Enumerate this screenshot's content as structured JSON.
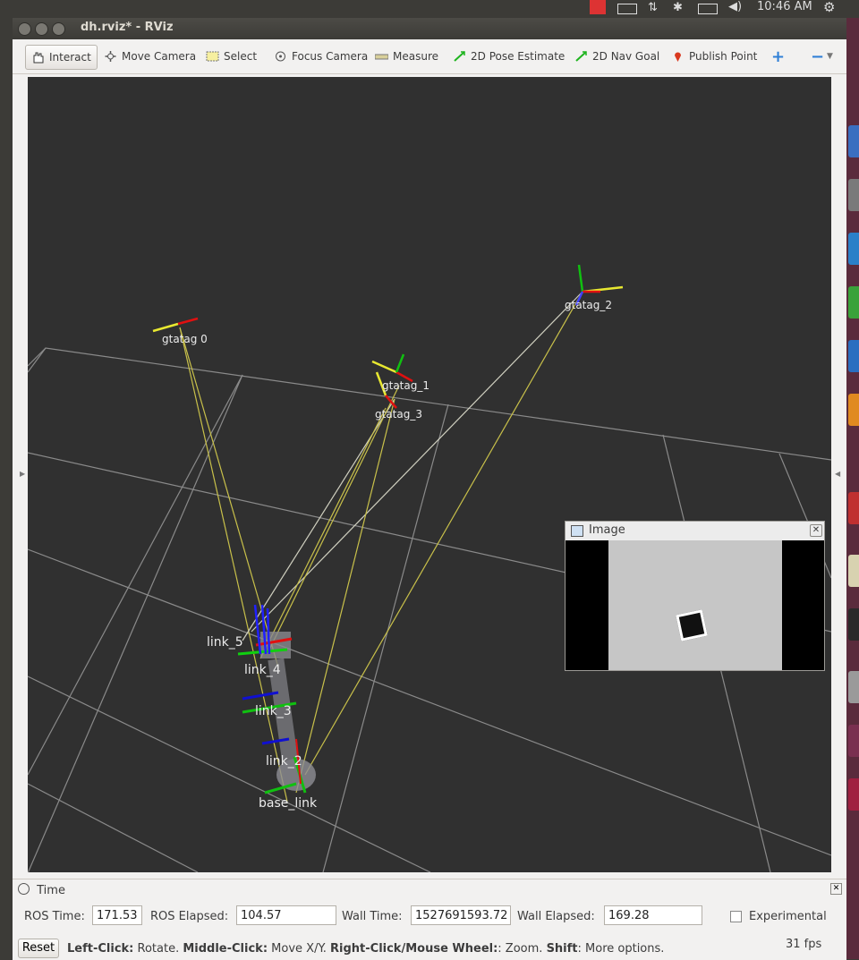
{
  "top_panel": {
    "time": "10:46 AM"
  },
  "window": {
    "title": "dh.rviz* - RViz"
  },
  "toolbar": {
    "tools": [
      {
        "label": "Interact"
      },
      {
        "label": "Move Camera"
      },
      {
        "label": "Select"
      },
      {
        "label": "Focus Camera"
      },
      {
        "label": "Measure"
      },
      {
        "label": "2D Pose Estimate"
      },
      {
        "label": "2D Nav Goal"
      },
      {
        "label": "Publish Point"
      }
    ]
  },
  "viewport": {
    "frames": [
      {
        "label": "gtatag 0"
      },
      {
        "label": "gtatag_1"
      },
      {
        "label": "gtatag_2"
      },
      {
        "label": "gtatag_3"
      },
      {
        "label": "link_4"
      },
      {
        "label": "link_3"
      },
      {
        "label": "link_2"
      },
      {
        "label": "base_link"
      },
      {
        "label": "link_5"
      }
    ]
  },
  "image_panel": {
    "title": "Image"
  },
  "time_panel": {
    "title": "Time",
    "ros_time_label": "ROS Time:",
    "ros_time": "171.53",
    "ros_elapsed_label": "ROS Elapsed:",
    "ros_elapsed": "104.57",
    "wall_time_label": "Wall Time:",
    "wall_time": "1527691593.72",
    "wall_elapsed_label": "Wall Elapsed:",
    "wall_elapsed": "169.28",
    "experimental_label": "Experimental"
  },
  "status_bar": {
    "reset_label": "Reset",
    "left_click": "Left-Click:",
    "left_click_desc": " Rotate. ",
    "middle_click": "Middle-Click:",
    "middle_click_desc": " Move X/Y. ",
    "right_click": "Right-Click/Mouse Wheel:",
    "right_click_desc": ": Zoom. ",
    "shift": "Shift",
    "shift_desc": ": More options.",
    "fps": "31 fps"
  }
}
